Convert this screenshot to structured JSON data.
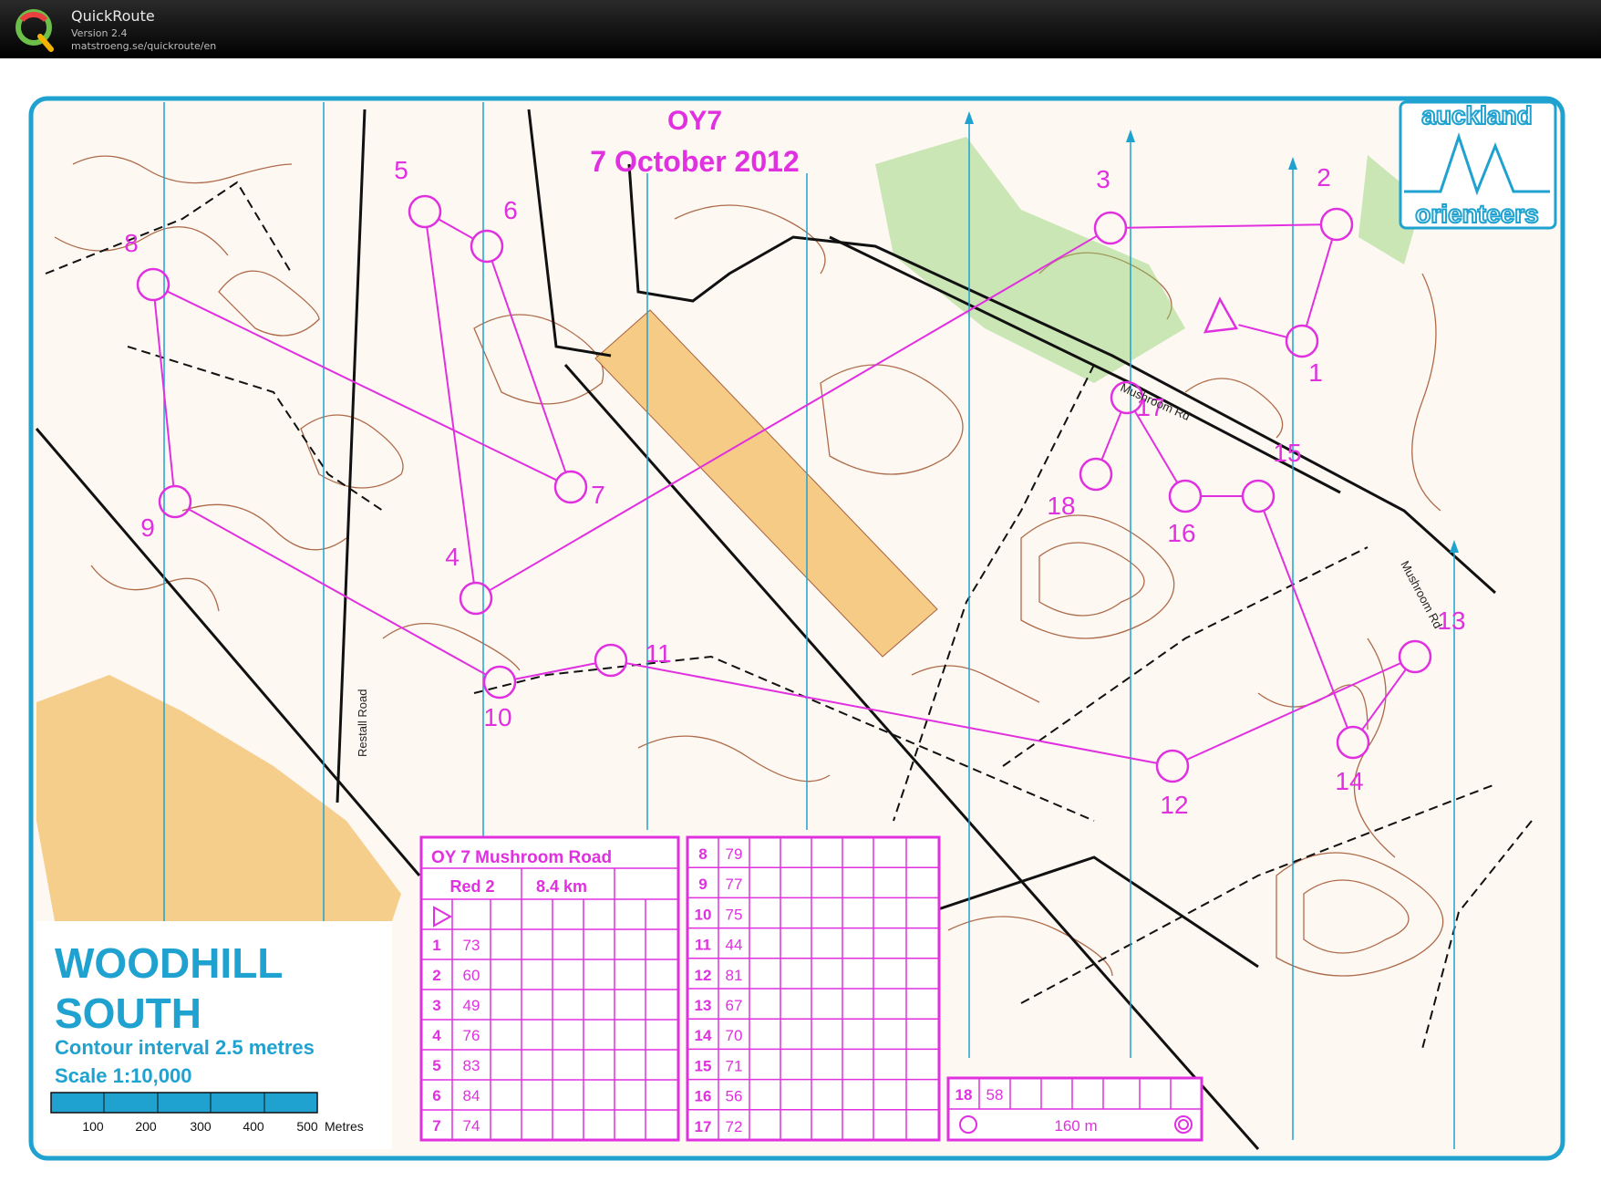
{
  "app": {
    "name": "QuickRoute",
    "version": "Version 2.4",
    "url": "matstroeng.se/quickroute/en"
  },
  "map": {
    "event_title": "OY7",
    "event_date": "7 October 2012",
    "club_logo_top": "auckland",
    "club_logo_bottom": "orienteers",
    "map_name_line1": "WOODHILL",
    "map_name_line2": "SOUTH",
    "contour_text": "Contour interval 2.5 metres",
    "scale_text": "Scale 1:10,000",
    "scalebar_labels": [
      "100",
      "200",
      "300",
      "400",
      "500"
    ],
    "scalebar_unit": "Metres",
    "road_label_1": "Restall Road",
    "road_label_2": "Mushroom Rd",
    "road_label_3": "Mushroom Rd",
    "colors": {
      "course": "#e030e0",
      "blue": "#1fa2d0",
      "contour": "#a0522d",
      "open": "#f5c77a",
      "green": "#8fd16a"
    },
    "controls": [
      {
        "n": "1"
      },
      {
        "n": "2"
      },
      {
        "n": "3"
      },
      {
        "n": "4"
      },
      {
        "n": "5"
      },
      {
        "n": "6"
      },
      {
        "n": "7"
      },
      {
        "n": "8"
      },
      {
        "n": "9"
      },
      {
        "n": "10"
      },
      {
        "n": "11"
      },
      {
        "n": "12"
      },
      {
        "n": "13"
      },
      {
        "n": "14"
      },
      {
        "n": "15"
      },
      {
        "n": "16"
      },
      {
        "n": "17"
      },
      {
        "n": "18"
      }
    ]
  },
  "description_sheet": {
    "title": "OY 7 Mushroom Road",
    "course": "Red 2",
    "length": "8.4 km",
    "left_rows": [
      {
        "num": "1",
        "code": "73"
      },
      {
        "num": "2",
        "code": "60"
      },
      {
        "num": "3",
        "code": "49"
      },
      {
        "num": "4",
        "code": "76"
      },
      {
        "num": "5",
        "code": "83"
      },
      {
        "num": "6",
        "code": "84"
      },
      {
        "num": "7",
        "code": "74"
      }
    ],
    "right_rows": [
      {
        "num": "8",
        "code": "79"
      },
      {
        "num": "9",
        "code": "77"
      },
      {
        "num": "10",
        "code": "75"
      },
      {
        "num": "11",
        "code": "44"
      },
      {
        "num": "12",
        "code": "81"
      },
      {
        "num": "13",
        "code": "67"
      },
      {
        "num": "14",
        "code": "70"
      },
      {
        "num": "15",
        "code": "71"
      },
      {
        "num": "16",
        "code": "56"
      },
      {
        "num": "17",
        "code": "72"
      }
    ],
    "last_row": {
      "num": "18",
      "code": "58"
    },
    "finish_distance": "160 m"
  }
}
